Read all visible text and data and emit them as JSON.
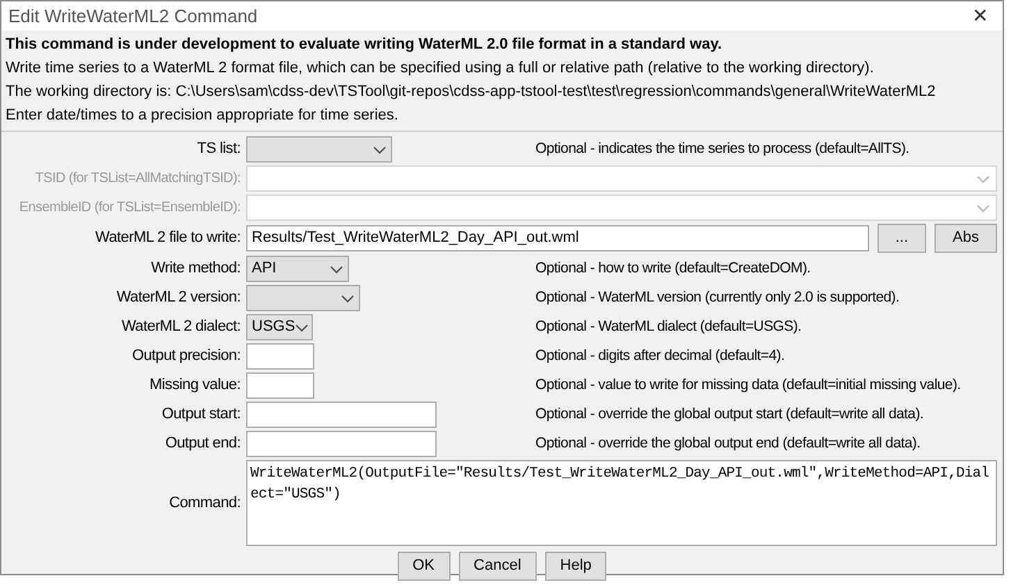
{
  "window": {
    "title": "Edit WriteWaterML2 Command",
    "close": "✕"
  },
  "intro": [
    {
      "text": "This command is under development to evaluate writing WaterML 2.0 file format in a standard way.",
      "bold": true
    },
    {
      "text": "Write time series to a WaterML 2 format file, which can be specified using a full or relative path (relative to the working directory).",
      "bold": false
    },
    {
      "text": "The working directory is: C:\\Users\\sam\\cdss-dev\\TSTool\\git-repos\\cdss-app-tstool-test\\test\\regression\\commands\\general\\WriteWaterML2",
      "bold": false
    },
    {
      "text": "Enter date/times to a precision appropriate for time series.",
      "bold": false
    }
  ],
  "fields": [
    {
      "kind": "combo",
      "label": "TS list:",
      "disabled": false,
      "description": "Optional - indicates the time series to process (default=AllTS)."
    },
    {
      "kind": "wide-combo",
      "label": "TSID (for TSList=AllMatchingTSID):",
      "disabled": true
    },
    {
      "kind": "wide-combo",
      "label": "EnsembleID (for TSList=EnsembleID):",
      "disabled": true
    },
    {
      "kind": "file",
      "label": "WaterML 2 file to write:",
      "disabled": false,
      "value": "Results/Test_WriteWaterML2_Day_API_out.wml",
      "buttons": [
        "...",
        "Abs"
      ]
    },
    {
      "kind": "combo",
      "label": "Write method:",
      "disabled": false,
      "value": "API",
      "description": "Optional - how to write (default=CreateDOM)."
    },
    {
      "kind": "combo",
      "label": "WaterML 2 version:",
      "disabled": false,
      "description": "Optional - WaterML version (currently only 2.0 is supported)."
    },
    {
      "kind": "combo",
      "label": "WaterML 2 dialect:",
      "disabled": false,
      "value": "USGS",
      "description": "Optional - WaterML dialect (default=USGS)."
    },
    {
      "kind": "text",
      "label": "Output precision:",
      "disabled": false,
      "description": "Optional - digits after decimal (default=4)."
    },
    {
      "kind": "text",
      "label": "Missing value:",
      "disabled": false,
      "description": "Optional - value to write for missing data (default=initial missing value)."
    },
    {
      "kind": "text",
      "label": "Output start:",
      "disabled": false,
      "description": "Optional - override the global output start (default=write all data)."
    },
    {
      "kind": "text",
      "label": "Output end:",
      "disabled": false,
      "description": "Optional - override the global output end (default=write all data)."
    },
    {
      "kind": "command",
      "label": "Command:",
      "disabled": false,
      "value": "WriteWaterML2(OutputFile=\"Results/Test_WriteWaterML2_Day_API_out.wml\",WriteMethod=API,Dialect=\"USGS\")"
    }
  ],
  "buttons": [
    "OK",
    "Cancel",
    "Help"
  ]
}
